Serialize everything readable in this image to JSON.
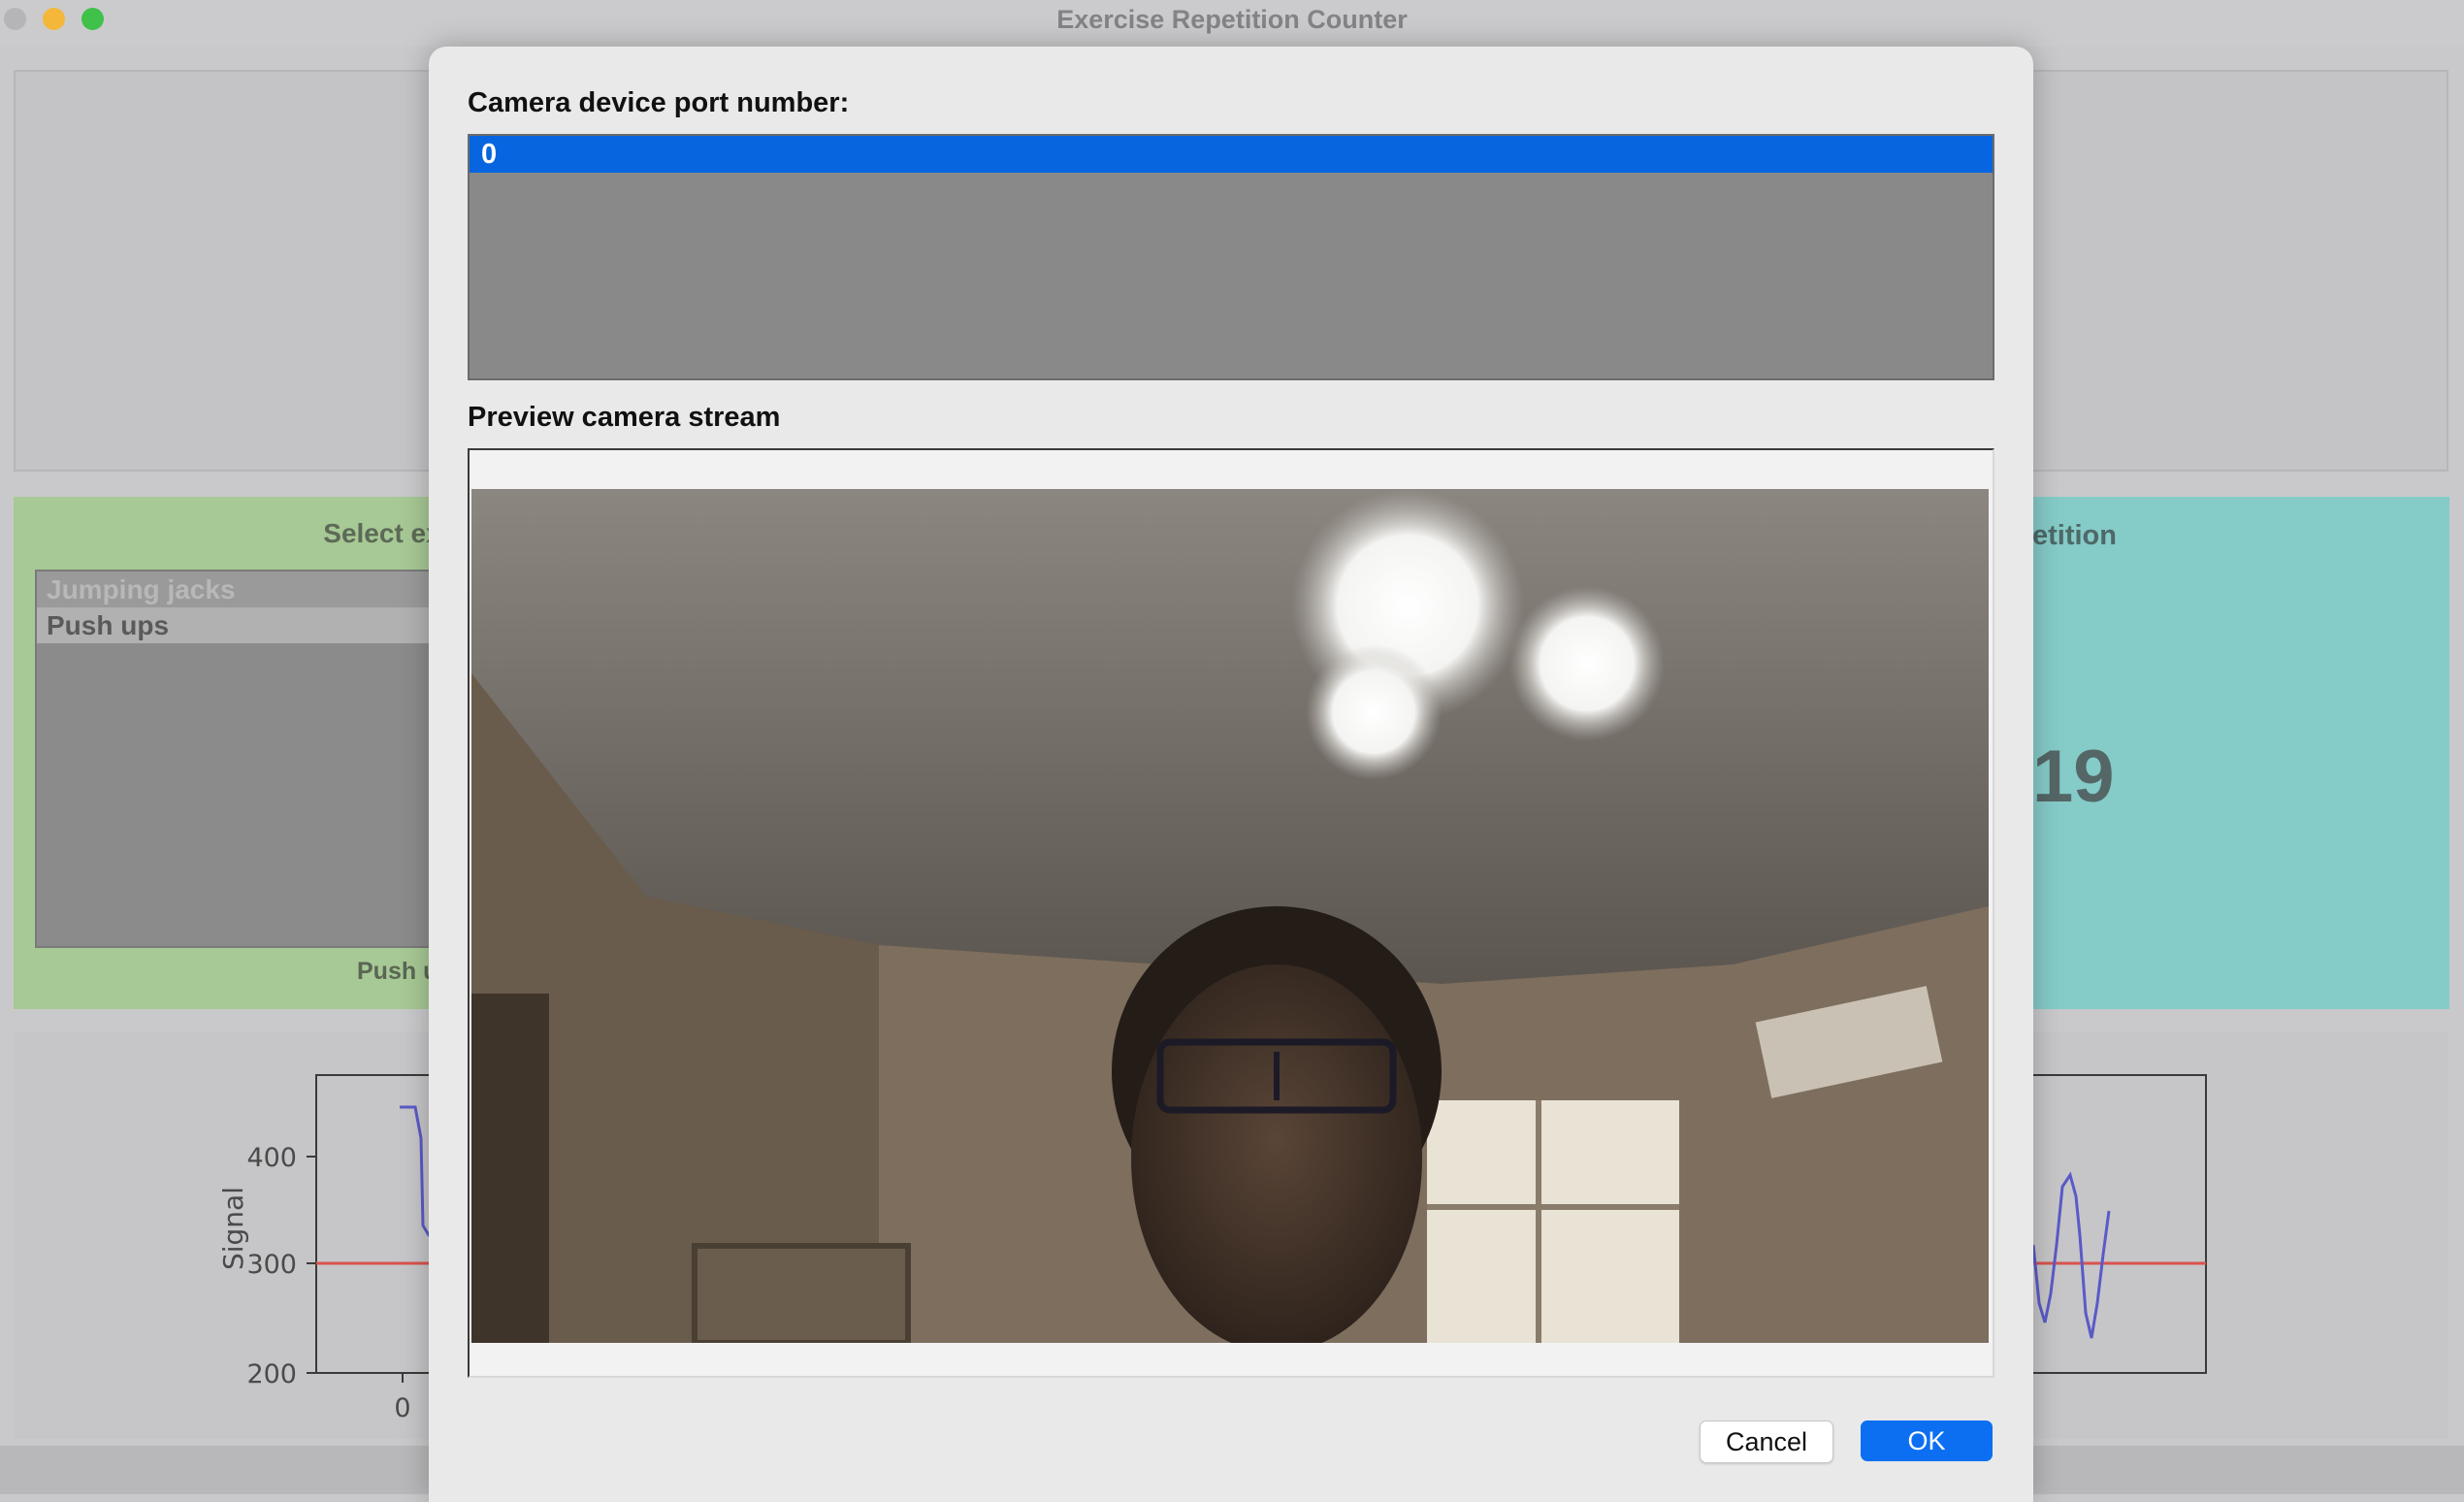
{
  "window": {
    "title": "Exercise Repetition Counter"
  },
  "colors": {
    "accent": "#0865e0",
    "green_panel": "#a7c995",
    "teal_panel": "#85cbc8",
    "threshold_line": "#d9534f",
    "signal_line": "#5a5ac8"
  },
  "exercise_panel": {
    "label": "Select ex",
    "items": [
      "Jumping jacks",
      "Push ups"
    ],
    "status": "Push u"
  },
  "counter_panel": {
    "label": "etition",
    "count": "19"
  },
  "plot": {
    "ylabel": "Signal",
    "yticks": [
      "400",
      "300",
      "200"
    ],
    "xticks": [
      "0"
    ],
    "threshold": 300
  },
  "dialog": {
    "port_label": "Camera device port number:",
    "ports": [
      "0"
    ],
    "preview_label": "Preview camera stream",
    "cancel": "Cancel",
    "ok": "OK"
  }
}
